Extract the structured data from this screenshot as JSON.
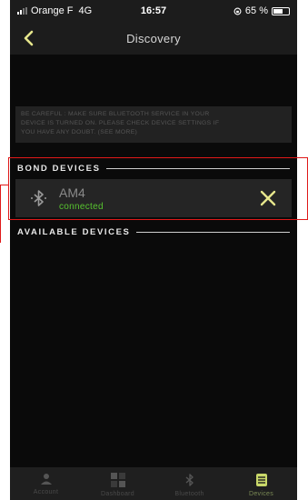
{
  "status_bar": {
    "carrier": "Orange F",
    "network": "4G",
    "time": "16:57",
    "battery_label": "65 %",
    "battery_percent": 65
  },
  "header": {
    "title": "Discovery",
    "back_icon": "chevron-left-icon"
  },
  "warning": {
    "lines": [
      "BE CAREFUL : MAKE SURE BLUETOOTH SERVICE IN YOUR",
      "DEVICE IS TURNED ON. PLEASE CHECK DEVICE SETTINGS IF",
      "YOU HAVE ANY DOUBT. (SEE MORE)"
    ]
  },
  "bond_devices": {
    "title": "BOND DEVICES",
    "items": [
      {
        "name": "AM4",
        "status": "connected"
      }
    ]
  },
  "available_devices": {
    "title": "AVAILABLE DEVICES"
  },
  "tabbar": {
    "tabs": [
      {
        "label": "Account",
        "icon": "user-icon",
        "active": false
      },
      {
        "label": "Dashboard",
        "icon": "dashboard-icon",
        "active": false
      },
      {
        "label": "Bluetooth",
        "icon": "bluetooth-icon",
        "active": false
      },
      {
        "label": "Devices",
        "icon": "devices-icon",
        "active": true
      }
    ]
  },
  "colors": {
    "accent": "#e6e68c",
    "connected": "#57c32f",
    "highlight": "#e01919",
    "background": "#0a0a0a"
  }
}
